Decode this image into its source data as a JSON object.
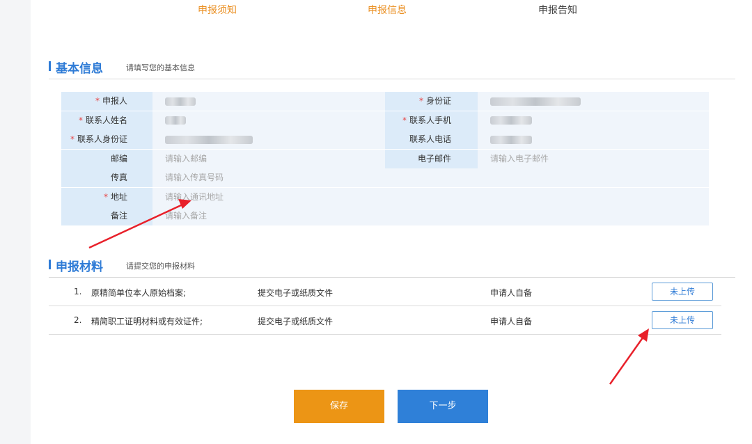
{
  "colors": {
    "accent_orange": "#ea8e1f",
    "accent_blue": "#2e7bd6",
    "label_bg": "#dcebf9",
    "value_bg": "#f0f5fb",
    "required": "#e64545",
    "arrow_red": "#e8202a",
    "save_btn": "#ec9515",
    "next_btn": "#2f80d8"
  },
  "steps": [
    {
      "label": "申报须知",
      "active": true
    },
    {
      "label": "申报信息",
      "active": true
    },
    {
      "label": "申报告知",
      "active": false
    }
  ],
  "basic_info": {
    "title": "基本信息",
    "hint": "请填写您的基本信息",
    "rows": [
      {
        "left": {
          "label": "申报人",
          "required": true,
          "value": "",
          "placeholder": "",
          "blurred": true
        },
        "right": {
          "label": "身份证",
          "required": true,
          "value": "",
          "placeholder": "",
          "blurred": true
        }
      },
      {
        "left": {
          "label": "联系人姓名",
          "required": true,
          "value": "",
          "placeholder": "",
          "blurred": true
        },
        "right": {
          "label": "联系人手机",
          "required": true,
          "value": "",
          "placeholder": "",
          "blurred": true
        }
      },
      {
        "left": {
          "label": "联系人身份证",
          "required": true,
          "value": "",
          "placeholder": "",
          "blurred": true
        },
        "right": {
          "label": "联系人电话",
          "required": false,
          "value": "",
          "placeholder": "",
          "blurred": true
        }
      },
      {
        "left": {
          "label": "邮编",
          "required": false,
          "value": "",
          "placeholder": "请输入邮编",
          "blurred": false
        },
        "right": {
          "label": "电子邮件",
          "required": false,
          "value": "",
          "placeholder": "请输入电子邮件",
          "blurred": false
        }
      }
    ],
    "wide_rows": [
      {
        "label": "传真",
        "required": false,
        "placeholder": "请输入传真号码"
      },
      {
        "label": "地址",
        "required": true,
        "placeholder": "请输入通讯地址"
      },
      {
        "label": "备注",
        "required": false,
        "placeholder": "请输入备注"
      }
    ]
  },
  "materials": {
    "title": "申报材料",
    "hint": "请提交您的申报材料",
    "items": [
      {
        "num": "1.",
        "name": "原精简单位本人原始档案;",
        "type": "提交电子或纸质文件",
        "source": "申请人自备",
        "status": "未上传"
      },
      {
        "num": "2.",
        "name": "精简职工证明材料或有效证件;",
        "type": "提交电子或纸质文件",
        "source": "申请人自备",
        "status": "未上传"
      }
    ]
  },
  "buttons": {
    "save": "保存",
    "next": "下一步"
  }
}
